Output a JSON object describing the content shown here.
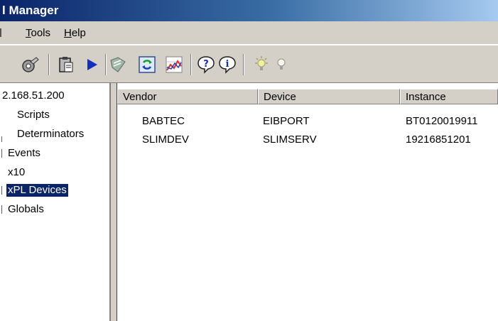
{
  "window": {
    "title": "l Manager"
  },
  "menu": {
    "items": [
      "Tools",
      "Help"
    ],
    "underline": [
      "T",
      "H"
    ]
  },
  "toolbar": {
    "buttons": [
      "properties-icon",
      "clipboard-icon",
      "play-icon",
      "script-icon",
      "refresh-icon",
      "graph-icon",
      "help-icon",
      "info-icon",
      "light-on-icon",
      "light-off-icon"
    ]
  },
  "tree": {
    "root": "2.168.51.200",
    "items": [
      "Scripts",
      "Determinators",
      "Events",
      "x10",
      "xPL Devices",
      "Globals"
    ],
    "selected": "xPL Devices"
  },
  "list": {
    "columns": [
      "Vendor",
      "Device",
      "Instance"
    ],
    "rows": [
      [
        "BABTEC",
        "EIBPORT",
        "BT0120019911"
      ],
      [
        "SLIMDEV",
        "SLIMSERV",
        "19216851201"
      ]
    ]
  },
  "colors": {
    "titlebar_start": "#0a246a",
    "titlebar_end": "#a6caf0",
    "chrome": "#d4d0c8",
    "selection": "#0a246a"
  }
}
